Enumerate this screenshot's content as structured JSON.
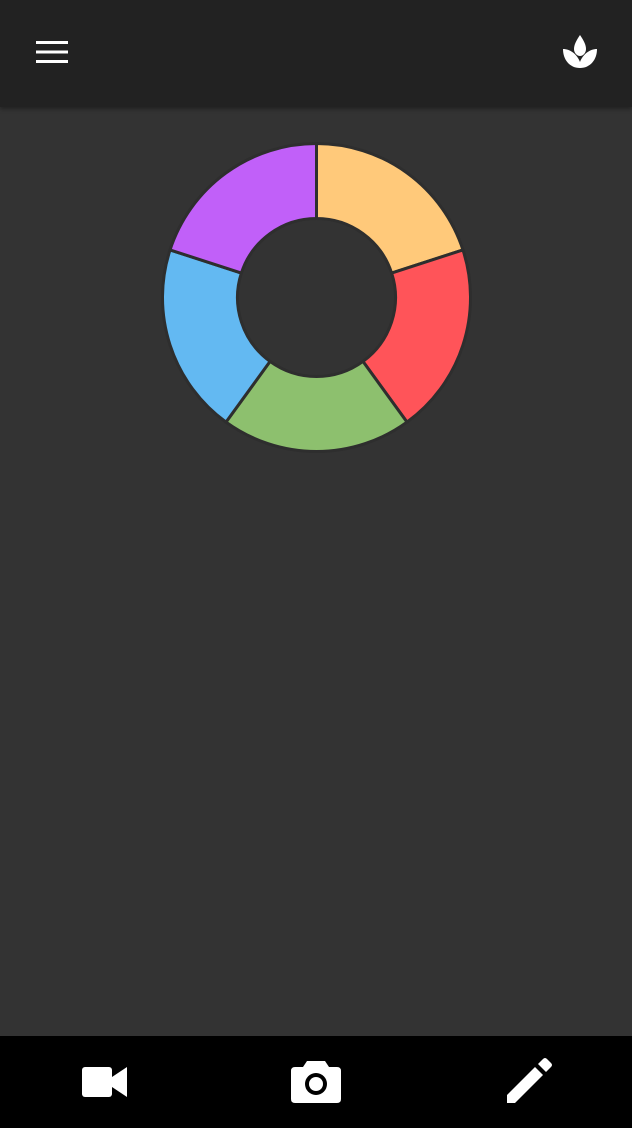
{
  "topbar": {
    "menu_icon": "hamburger-menu-icon",
    "right_icon": "lotus-icon"
  },
  "chart_data": {
    "type": "pie",
    "style": "donut",
    "values": [
      20,
      20,
      20,
      20,
      20
    ],
    "colors": [
      "#FFC97A",
      "#FF5459",
      "#8DC06E",
      "#63B9F2",
      "#C160F9"
    ],
    "separator_color": "#2E2E2E"
  },
  "bottombar": {
    "left_icon": "video-camera-icon",
    "center_icon": "photo-camera-icon",
    "right_icon": "pencil-icon"
  },
  "colors": {
    "background": "#333333",
    "topbar": "#222222",
    "bottombar": "#000000",
    "icon": "#FFFFFF"
  }
}
